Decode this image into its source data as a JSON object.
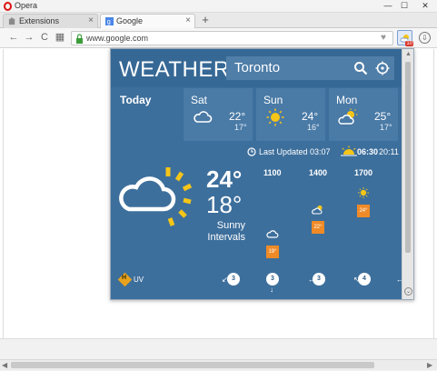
{
  "window": {
    "app_name": "Opera",
    "min_glyph": "—",
    "max_glyph": "☐",
    "close_glyph": "✕"
  },
  "tabs": [
    {
      "title": "Extensions",
      "icon": "puzzle-icon",
      "active": false
    },
    {
      "title": "Google",
      "icon": "google-g-icon",
      "active": true
    }
  ],
  "tab_close_glyph": "×",
  "new_tab_glyph": "+",
  "toolbar": {
    "back_glyph": "←",
    "forward_glyph": "→",
    "reload_glyph": "C",
    "speed_dial_glyph": "▦",
    "url": "www.google.com",
    "heart_glyph": "♥",
    "badge_count": "10",
    "download_glyph": "⇩"
  },
  "weather": {
    "logo": "WEATHER",
    "city": "Toronto",
    "today_label": "Today",
    "days": [
      {
        "name": "Sat",
        "icon": "cloud-icon",
        "high": "22°",
        "low": "17°"
      },
      {
        "name": "Sun",
        "icon": "sun-icon",
        "high": "24°",
        "low": "16°"
      },
      {
        "name": "Mon",
        "icon": "partly-cloudy-icon",
        "high": "25°",
        "low": "17°"
      }
    ],
    "updated": "Last Updated 03:07",
    "sunrise": "06:30",
    "sunset": "20:11",
    "current_temp": "24°",
    "feels_like": "18°",
    "condition_line1": "Sunny",
    "condition_line2": "Intervals",
    "hours": [
      {
        "time": "1100",
        "icon": "cloud-icon",
        "temp": "19°"
      },
      {
        "time": "1400",
        "icon": "partly-cloudy-icon",
        "temp": "22°"
      },
      {
        "time": "1700",
        "icon": "sun-icon",
        "temp": "24°"
      }
    ],
    "uv_letter": "H",
    "uv_label": "UV",
    "winds": [
      "3",
      "3",
      "3",
      "4"
    ],
    "colors": {
      "panel": "#3d6f9c",
      "header": "#366895",
      "card": "#4a7aa6",
      "sun": "#f5c518",
      "temp_badge": "#f08a26"
    }
  },
  "scrollbar": {
    "up_glyph": "▲",
    "down_glyph": "⌄",
    "left_glyph": "◀",
    "right_glyph": "▶"
  }
}
